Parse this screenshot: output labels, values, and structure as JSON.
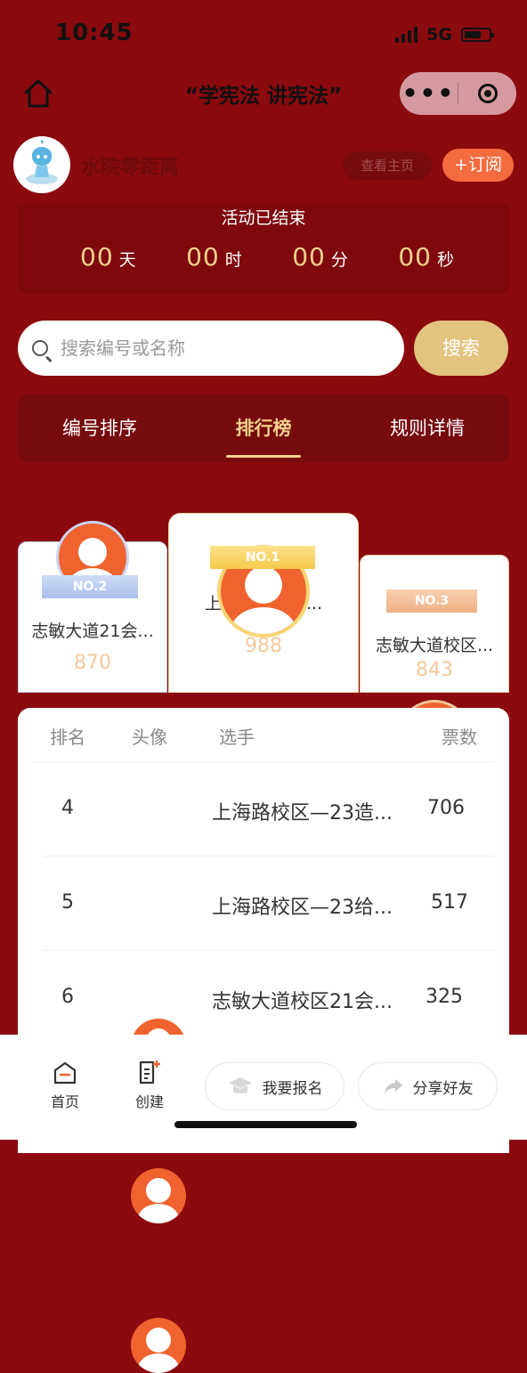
{
  "status_bar": {
    "time": "10:45",
    "network": "5G"
  },
  "nav": {
    "title": "“学宪法 讲宪法”"
  },
  "account": {
    "name": "水院零距离",
    "view_home": "查看主页",
    "subscribe": "+订阅"
  },
  "countdown": {
    "status": "活动已结束",
    "items": [
      {
        "value": "00",
        "unit": "天"
      },
      {
        "value": "00",
        "unit": "时"
      },
      {
        "value": "00",
        "unit": "分"
      },
      {
        "value": "00",
        "unit": "秒"
      }
    ]
  },
  "search": {
    "placeholder": "搜索编号或名称",
    "button": "搜索"
  },
  "tabs": [
    {
      "label": "编号排序",
      "active": false
    },
    {
      "label": "排行榜",
      "active": true
    },
    {
      "label": "规则详情",
      "active": false
    }
  ],
  "podium": {
    "first": {
      "badge": "NO.1",
      "name": "上海路校区—...",
      "votes": "988"
    },
    "second": {
      "badge": "NO.2",
      "name": "志敏大道21会...",
      "votes": "870"
    },
    "third": {
      "badge": "NO.3",
      "name": "志敏大道校区...",
      "votes": "843"
    }
  },
  "list": {
    "headers": {
      "rank": "排名",
      "avatar": "头像",
      "player": "选手",
      "votes": "票数"
    },
    "rows": [
      {
        "rank": "4",
        "name": "上海路校区—23造...",
        "votes": "706"
      },
      {
        "rank": "5",
        "name": "上海路校区—23给...",
        "votes": "517"
      },
      {
        "rank": "6",
        "name": "志敏大道校区21会...",
        "votes": "325"
      }
    ]
  },
  "bottom_bar": {
    "home": "首页",
    "create": "创建",
    "register": "我要报名",
    "share": "分享好友"
  },
  "colors": {
    "background": "#8a0a0e",
    "accent_gold": "#f3cf8a",
    "accent_orange": "#f0632f"
  }
}
